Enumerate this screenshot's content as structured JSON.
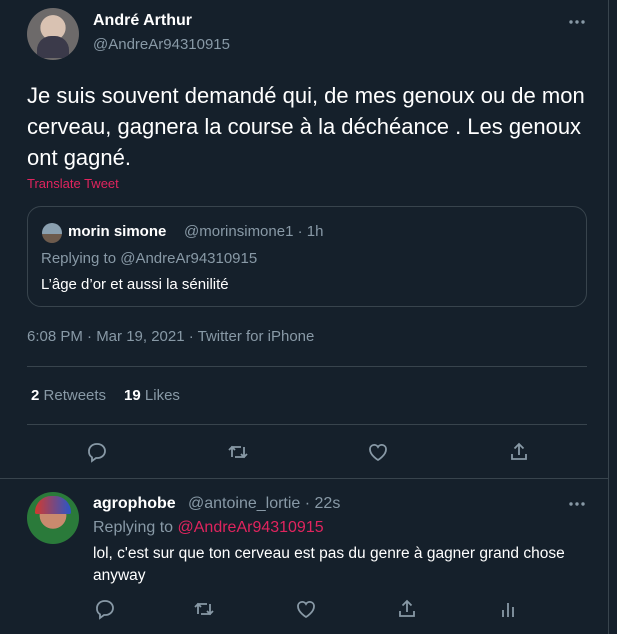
{
  "tweet": {
    "author_name": "André Arthur",
    "author_handle": "@AndreAr94310915",
    "text": "Je suis souvent demandé qui, de mes genoux ou de mon cerveau, gagnera la course à la déchéance . Les genoux ont gagné.",
    "translate_label": "Translate Tweet",
    "timestamp": "6:08 PM · Mar 19, 2021 · Twitter for iPhone",
    "retweets_count": "2",
    "retweets_label": "Retweets",
    "likes_count": "19",
    "likes_label": "Likes"
  },
  "quote": {
    "author_name": "morin simone",
    "meta": "@morinsimone1 · 1h",
    "replying_prefix": "Replying to",
    "replying_handle": "@AndreAr94310915",
    "text": "L’âge d’or et aussi la sénilité"
  },
  "reply": {
    "author_name": "agrophobe",
    "meta": "@antoine_lortie · 22s",
    "replying_prefix": "Replying to",
    "replying_handle": "@AndreAr94310915",
    "text": "lol, c'est sur que ton cerveau est pas du genre à gagner grand chose anyway"
  },
  "colors": {
    "background": "#15202b",
    "muted_text": "#8899a6",
    "border": "#38444d",
    "accent_link": "#e0245e"
  },
  "icons": {
    "more": "more-horizontal-icon",
    "reply": "reply-bubble-icon",
    "retweet": "retweet-icon",
    "like": "heart-icon",
    "share": "share-upload-icon",
    "analytics": "analytics-bars-icon"
  }
}
